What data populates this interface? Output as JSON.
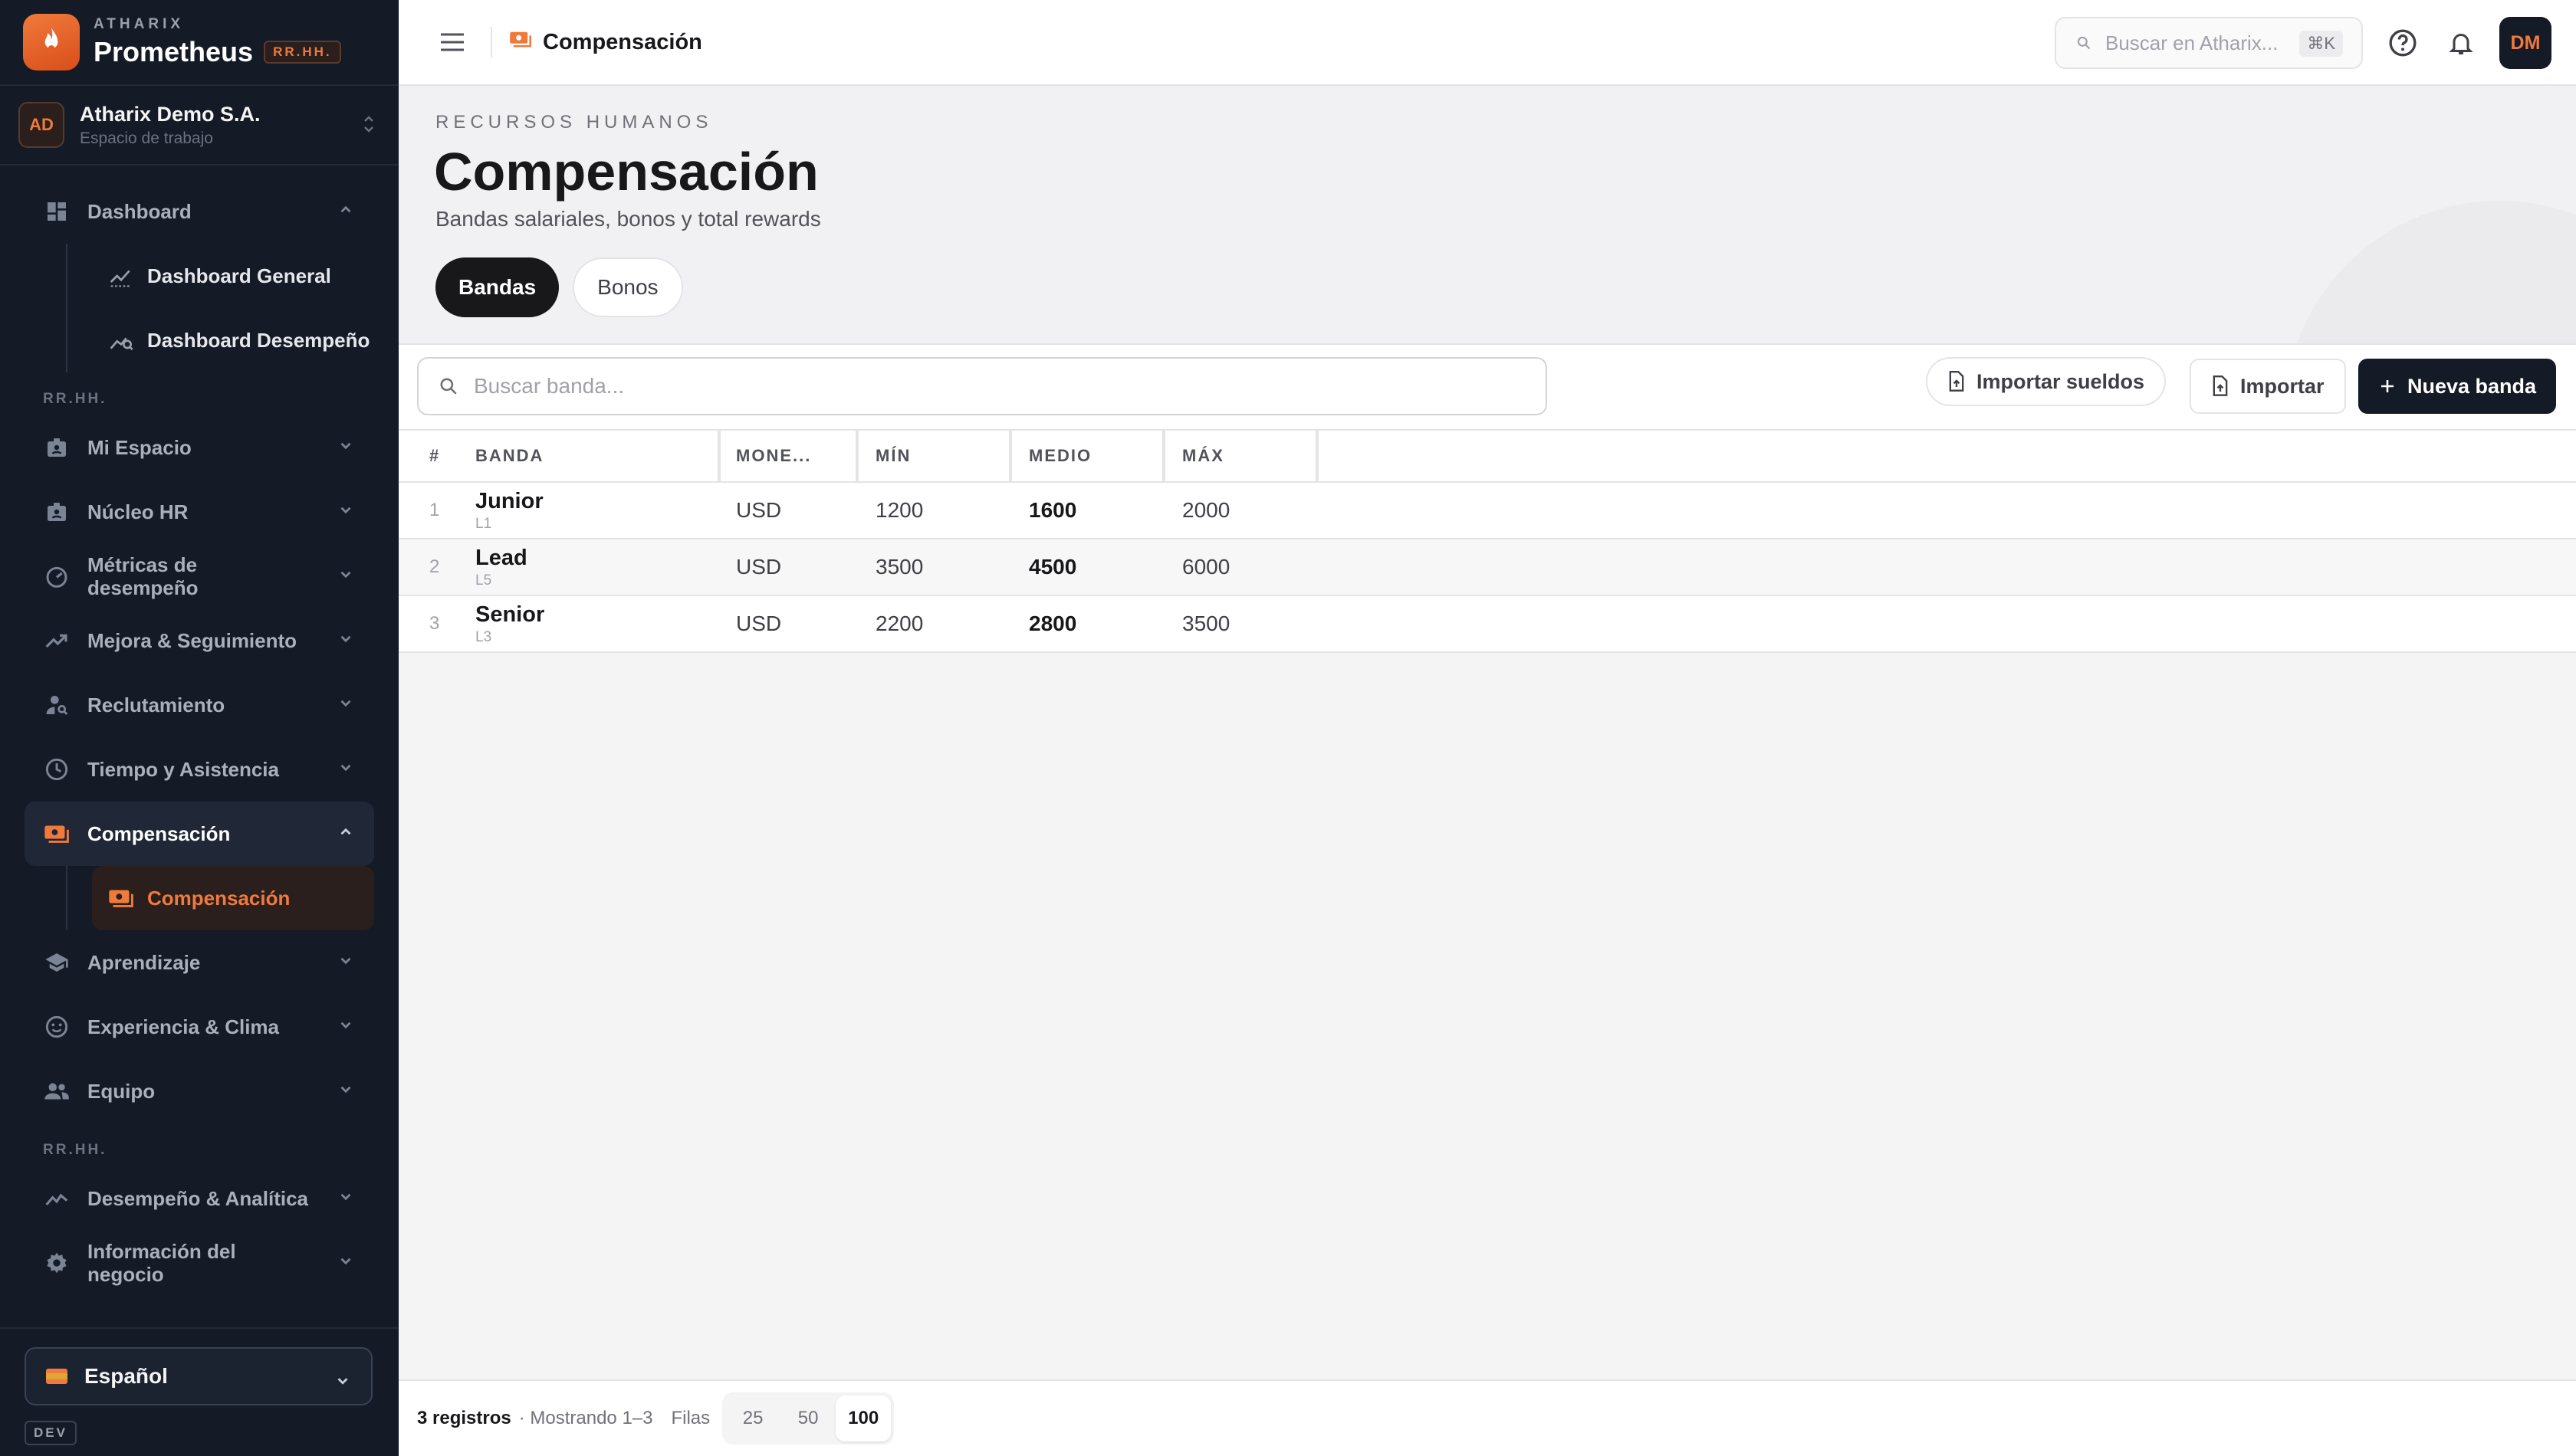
{
  "app": {
    "eyebrow": "ATHARIX",
    "name": "Prometheus",
    "tag": "RR.HH."
  },
  "workspace": {
    "initials": "AD",
    "name": "Atharix Demo S.A.",
    "sub": "Espacio de trabajo"
  },
  "sidebar": {
    "dashboard": {
      "label": "Dashboard",
      "children": [
        "Dashboard General",
        "Dashboard Desempeño"
      ]
    },
    "section1": "RR.HH.",
    "items1": [
      "Mi Espacio",
      "Núcleo HR",
      "Métricas de desempeño",
      "Mejora & Seguimiento",
      "Reclutamiento",
      "Tiempo y Asistencia"
    ],
    "compensation": {
      "label": "Compensación",
      "child": "Compensación"
    },
    "items2": [
      "Aprendizaje",
      "Experiencia & Clima",
      "Equipo"
    ],
    "section2": "RR.HH.",
    "items3": [
      "Desempeño & Analítica",
      "Información del negocio"
    ],
    "language": "Español",
    "env": "DEV"
  },
  "topbar": {
    "breadcrumb": "Compensación",
    "search_placeholder": "Buscar en Atharix...",
    "search_kbd": "⌘K",
    "avatar": "DM"
  },
  "page": {
    "eyebrow": "RECURSOS HUMANOS",
    "title": "Compensación",
    "subtitle": "Bandas salariales, bonos y total rewards",
    "tabs": [
      "Bandas",
      "Bonos"
    ],
    "active_tab": "Bandas"
  },
  "toolbar": {
    "search_placeholder": "Buscar banda...",
    "import_salaries": "Importar sueldos",
    "import": "Importar",
    "new_band": "Nueva banda"
  },
  "table": {
    "columns": [
      "#",
      "BANDA",
      "MONE...",
      "MÍN",
      "MEDIO",
      "MÁX"
    ],
    "rows": [
      {
        "idx": "1",
        "name": "Junior",
        "code": "L1",
        "currency": "USD",
        "min": "1200",
        "mid": "1600",
        "max": "2000"
      },
      {
        "idx": "2",
        "name": "Lead",
        "code": "L5",
        "currency": "USD",
        "min": "3500",
        "mid": "4500",
        "max": "6000"
      },
      {
        "idx": "3",
        "name": "Senior",
        "code": "L3",
        "currency": "USD",
        "min": "2200",
        "mid": "2800",
        "max": "3500"
      }
    ]
  },
  "footer": {
    "count": "3 registros",
    "showing": "· Mostrando 1–3",
    "rows_label": "Filas",
    "page_sizes": [
      "25",
      "50",
      "100"
    ],
    "active_size": "100"
  },
  "colors": {
    "accent": "#f07a3c",
    "sidebar_bg": "#141a26",
    "primary_button": "#141a26"
  }
}
